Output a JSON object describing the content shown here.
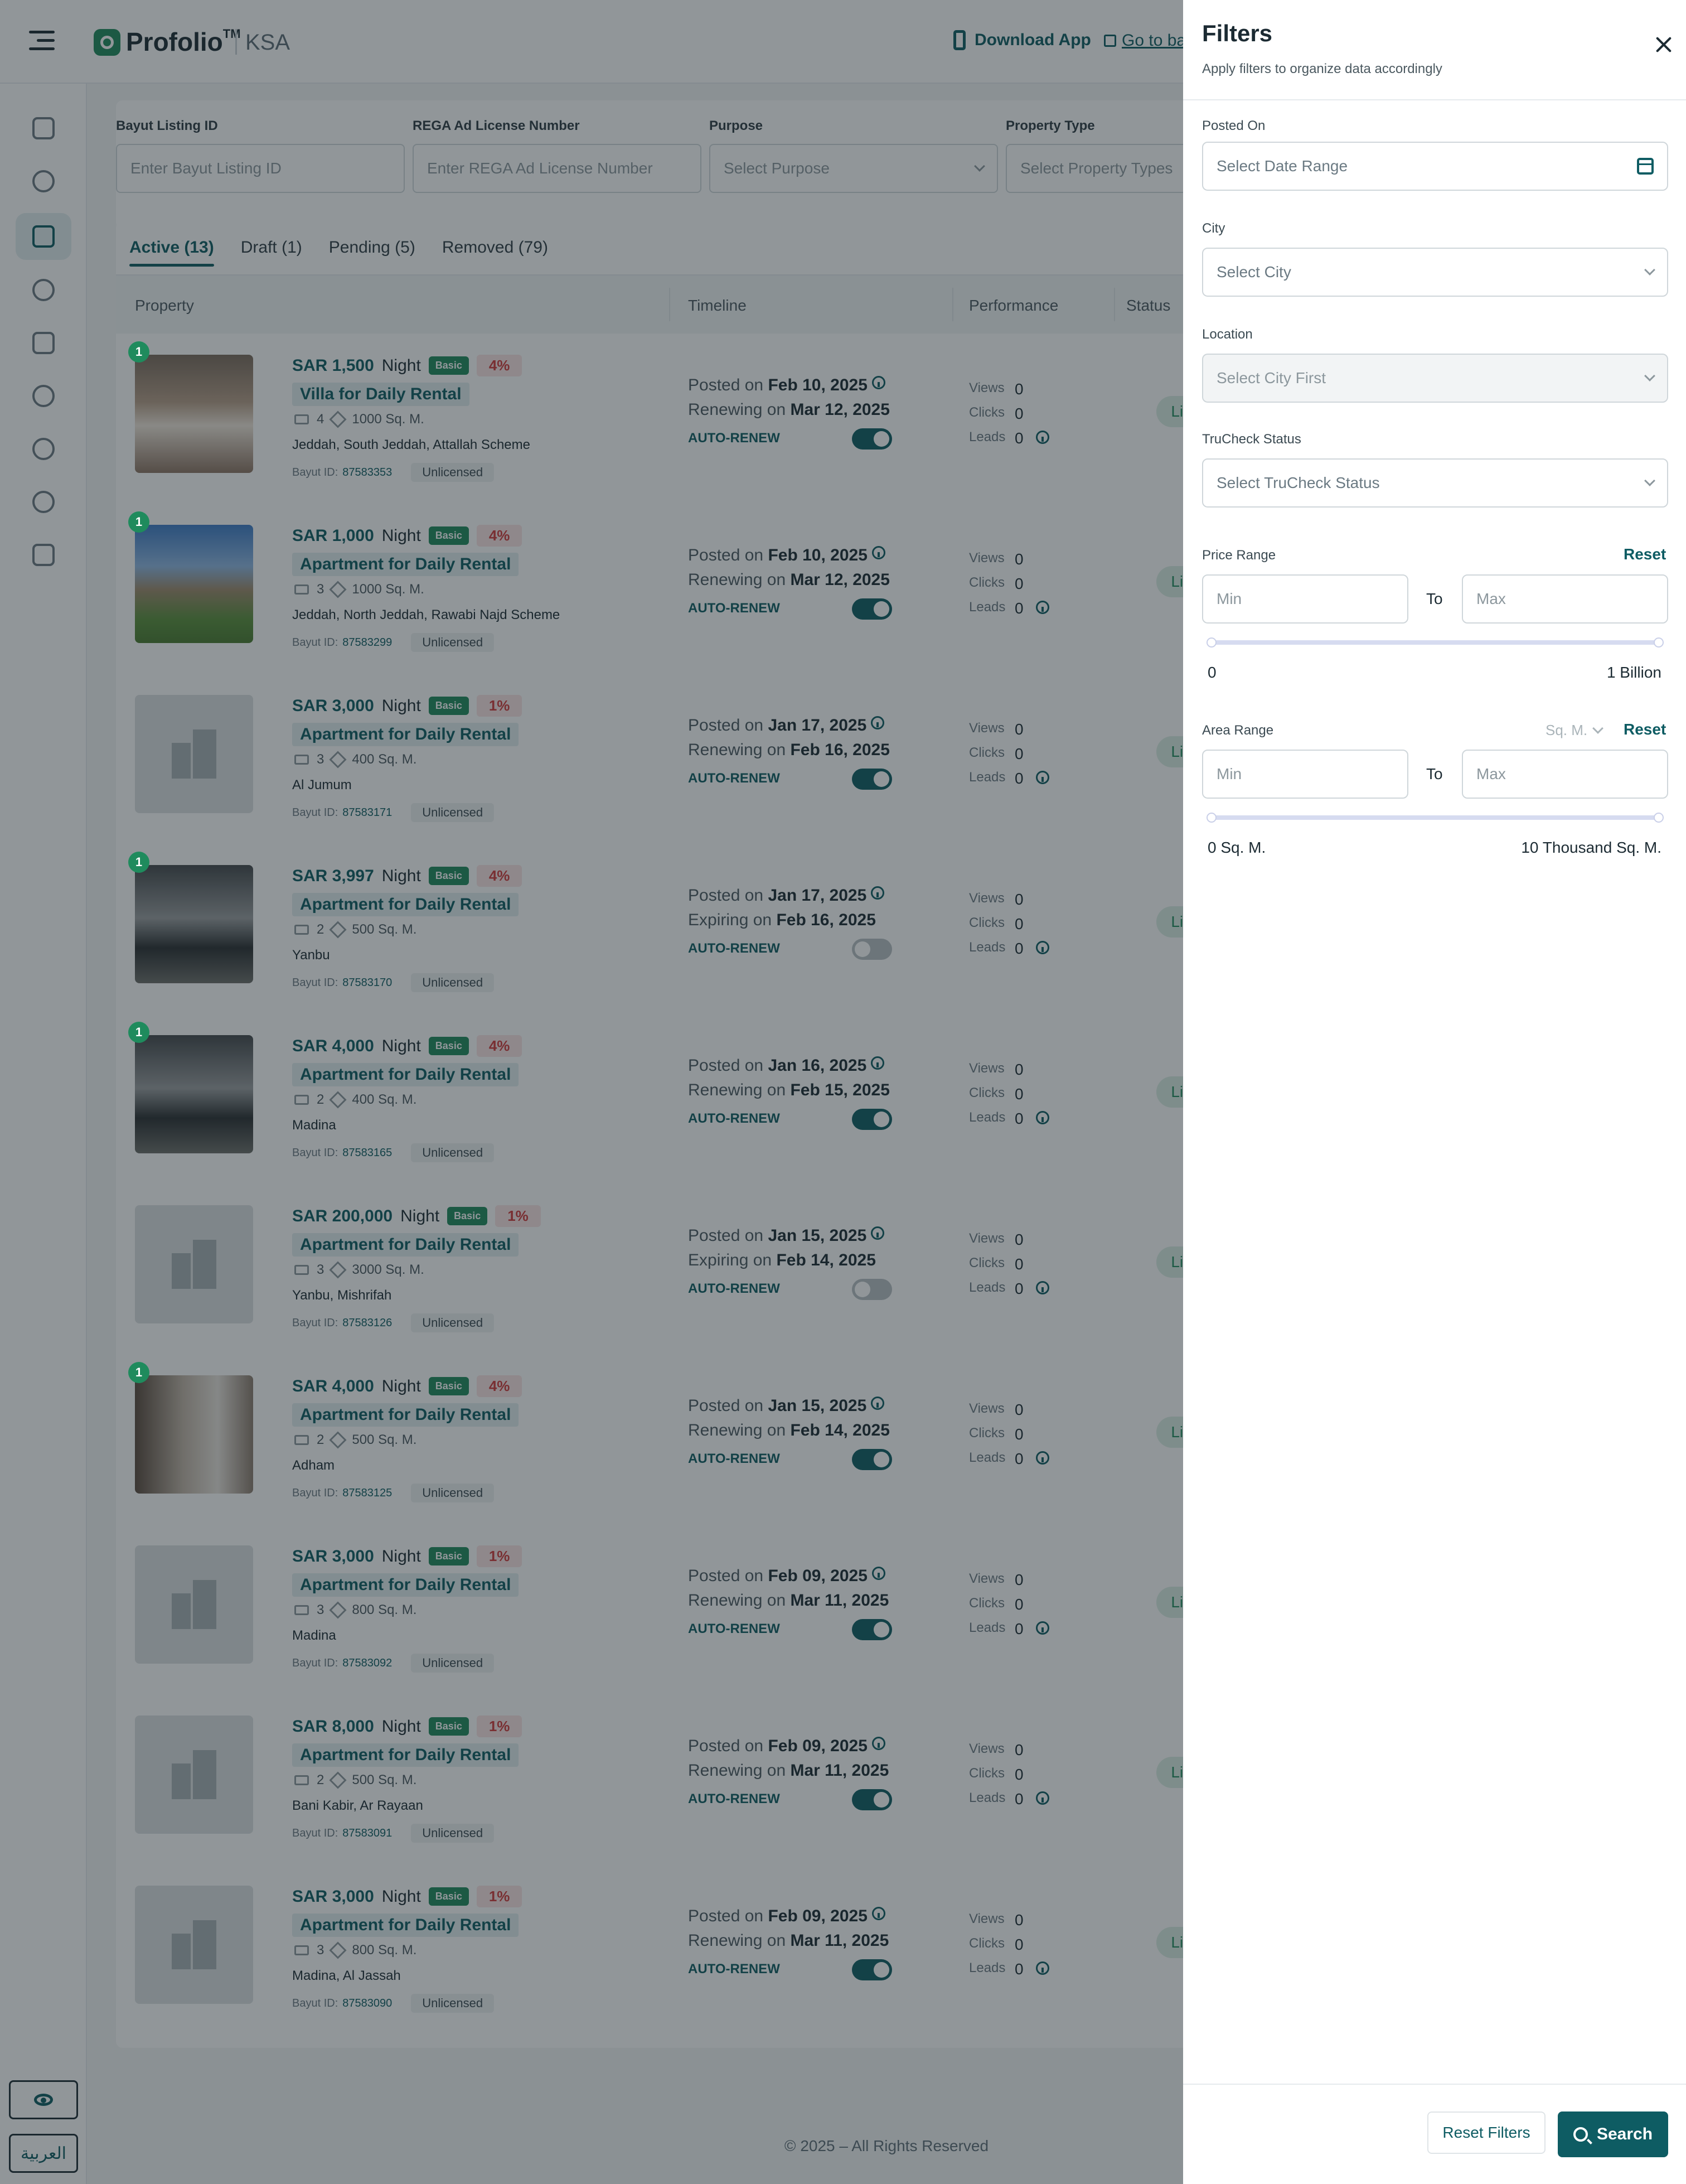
{
  "header": {
    "brand": "Profolio",
    "tm": "TM",
    "region": "KSA",
    "download_app": "Download App",
    "go_to_back": "Go to ba"
  },
  "sidebar": {
    "icons": [
      "dashboard-icon",
      "leads-icon",
      "listings-icon",
      "analytics-icon",
      "messages-icon",
      "reports-icon",
      "users-icon",
      "settings-icon",
      "credits-icon"
    ],
    "language_label": "العربية"
  },
  "filter_bar": {
    "listing_id_label": "Bayut Listing ID",
    "listing_id_placeholder": "Enter Bayut Listing ID",
    "rega_label": "REGA Ad License Number",
    "rega_placeholder": "Enter REGA Ad License Number",
    "purpose_label": "Purpose",
    "purpose_placeholder": "Select Purpose",
    "ptype_label": "Property Type",
    "ptype_placeholder": "Select Property Types"
  },
  "tabs": [
    {
      "label": "Active (13)"
    },
    {
      "label": "Draft (1)"
    },
    {
      "label": "Pending (5)"
    },
    {
      "label": "Removed (79)"
    }
  ],
  "table_headers": {
    "property": "Property",
    "timeline": "Timeline",
    "performance": "Performance",
    "status": "Status"
  },
  "labels": {
    "posted_on": "Posted on",
    "renewing_on": "Renewing on",
    "expiring_on": "Expiring on",
    "auto_renew": "AUTO-RENEW",
    "views": "Views",
    "clicks": "Clicks",
    "leads": "Leads",
    "bayut_id": "Bayut ID:",
    "unlicensed": "Unlicensed",
    "basic": "Basic",
    "night": "Night",
    "live": "Live"
  },
  "listings": [
    {
      "rank": "1",
      "price": "SAR 1,500",
      "pct": "4%",
      "type": "Villa for Daily Rental",
      "beds": "4",
      "area": "1000 Sq. M.",
      "location": "Jeddah, South Jeddah, Attallah Scheme",
      "bayut_id": "87583353",
      "posted": "Feb 10, 2025",
      "second_label": "Renewing on",
      "second_date": "Mar 12, 2025",
      "auto_renew": true,
      "views": "0",
      "clicks": "0",
      "leads": "0",
      "status": "Live",
      "photo": "room"
    },
    {
      "rank": "1",
      "price": "SAR 1,000",
      "pct": "4%",
      "type": "Apartment for Daily Rental",
      "beds": "3",
      "area": "1000 Sq. M.",
      "location": "Jeddah, North Jeddah, Rawabi Najd Scheme",
      "bayut_id": "87583299",
      "posted": "Feb 10, 2025",
      "second_label": "Renewing on",
      "second_date": "Mar 12, 2025",
      "auto_renew": true,
      "views": "0",
      "clicks": "0",
      "leads": "0",
      "status": "Live",
      "photo": "house"
    },
    {
      "rank": "",
      "price": "SAR 3,000",
      "pct": "1%",
      "type": "Apartment for Daily Rental",
      "beds": "3",
      "area": "400 Sq. M.",
      "location": "Al Jumum",
      "bayut_id": "87583171",
      "posted": "Jan 17, 2025",
      "second_label": "Renewing on",
      "second_date": "Feb 16, 2025",
      "auto_renew": true,
      "views": "0",
      "clicks": "0",
      "leads": "0",
      "status": "Live",
      "photo": "placeholder"
    },
    {
      "rank": "1",
      "price": "SAR 3,997",
      "pct": "4%",
      "type": "Apartment for Daily Rental",
      "beds": "2",
      "area": "500 Sq. M.",
      "location": "Yanbu",
      "bayut_id": "87583170",
      "posted": "Jan 17, 2025",
      "second_label": "Expiring on",
      "second_date": "Feb 16, 2025",
      "auto_renew": false,
      "views": "0",
      "clicks": "0",
      "leads": "0",
      "status": "Live",
      "photo": "hall"
    },
    {
      "rank": "1",
      "price": "SAR 4,000",
      "pct": "4%",
      "type": "Apartment for Daily Rental",
      "beds": "2",
      "area": "400 Sq. M.",
      "location": "Madina",
      "bayut_id": "87583165",
      "posted": "Jan 16, 2025",
      "second_label": "Renewing on",
      "second_date": "Feb 15, 2025",
      "auto_renew": true,
      "views": "0",
      "clicks": "0",
      "leads": "0",
      "status": "Live",
      "photo": "hall"
    },
    {
      "rank": "",
      "price": "SAR 200,000",
      "pct": "1%",
      "type": "Apartment for Daily Rental",
      "beds": "3",
      "area": "3000 Sq. M.",
      "location": "Yanbu, Mishrifah",
      "bayut_id": "87583126",
      "posted": "Jan 15, 2025",
      "second_label": "Expiring on",
      "second_date": "Feb 14, 2025",
      "auto_renew": false,
      "views": "0",
      "clicks": "0",
      "leads": "0",
      "status": "Live",
      "photo": "placeholder"
    },
    {
      "rank": "1",
      "price": "SAR 4,000",
      "pct": "4%",
      "type": "Apartment for Daily Rental",
      "beds": "2",
      "area": "500 Sq. M.",
      "location": "Adham",
      "bayut_id": "87583125",
      "posted": "Jan 15, 2025",
      "second_label": "Renewing on",
      "second_date": "Feb 14, 2025",
      "auto_renew": true,
      "views": "0",
      "clicks": "0",
      "leads": "0",
      "status": "Live",
      "photo": "bath"
    },
    {
      "rank": "",
      "price": "SAR 3,000",
      "pct": "1%",
      "type": "Apartment for Daily Rental",
      "beds": "3",
      "area": "800 Sq. M.",
      "location": "Madina",
      "bayut_id": "87583092",
      "posted": "Feb 09, 2025",
      "second_label": "Renewing on",
      "second_date": "Mar 11, 2025",
      "auto_renew": true,
      "views": "0",
      "clicks": "0",
      "leads": "0",
      "status": "Live",
      "photo": "placeholder"
    },
    {
      "rank": "",
      "price": "SAR 8,000",
      "pct": "1%",
      "type": "Apartment for Daily Rental",
      "beds": "2",
      "area": "500 Sq. M.",
      "location": "Bani Kabir, Ar Rayaan",
      "bayut_id": "87583091",
      "posted": "Feb 09, 2025",
      "second_label": "Renewing on",
      "second_date": "Mar 11, 2025",
      "auto_renew": true,
      "views": "0",
      "clicks": "0",
      "leads": "0",
      "status": "Live",
      "photo": "placeholder"
    },
    {
      "rank": "",
      "price": "SAR 3,000",
      "pct": "1%",
      "type": "Apartment for Daily Rental",
      "beds": "3",
      "area": "800 Sq. M.",
      "location": "Madina, Al Jassah",
      "bayut_id": "87583090",
      "posted": "Feb 09, 2025",
      "second_label": "Renewing on",
      "second_date": "Mar 11, 2025",
      "auto_renew": true,
      "views": "0",
      "clicks": "0",
      "leads": "0",
      "status": "Live",
      "photo": "placeholder"
    }
  ],
  "footer": "© 2025 – All Rights Reserved",
  "drawer": {
    "title": "Filters",
    "subtitle": "Apply filters to organize data accordingly",
    "posted_on_label": "Posted On",
    "posted_on_placeholder": "Select Date Range",
    "city_label": "City",
    "city_placeholder": "Select City",
    "location_label": "Location",
    "location_placeholder": "Select City First",
    "trucheck_label": "TruCheck Status",
    "trucheck_placeholder": "Select TruCheck Status",
    "price_label": "Price Range",
    "reset": "Reset",
    "min": "Min",
    "max": "Max",
    "to": "To",
    "price_min_value": "0",
    "price_max_value": "1 Billion",
    "area_label": "Area Range",
    "area_unit": "Sq. M.",
    "area_min_value": "0 Sq. M.",
    "area_max_value": "10 Thousand Sq. M.",
    "reset_filters": "Reset Filters",
    "search": "Search"
  }
}
